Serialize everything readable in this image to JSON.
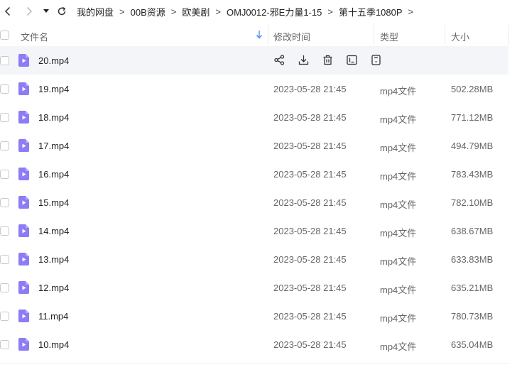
{
  "nav": {
    "back_icon": "chevron-left-icon",
    "forward_icon": "chevron-right-icon",
    "history_icon": "caret-down-icon",
    "refresh_icon": "refresh-icon"
  },
  "breadcrumb": {
    "items": [
      "我的网盘",
      "00B资源",
      "欧美剧",
      "OMJ0012-邪E力量1-15",
      "第十五季1080P"
    ],
    "separator": ">"
  },
  "table": {
    "columns": {
      "name": "文件名",
      "time": "修改时间",
      "type": "类型",
      "size": "大小"
    },
    "sort_icon": "sort-arrow-down-icon",
    "accent_color": "#4b8bf5",
    "file_icon_color": "#8c7cf5",
    "hover_row_actions": [
      "share-icon",
      "download-icon",
      "delete-icon",
      "rename-icon",
      "more-icon"
    ],
    "rows": [
      {
        "name": "20.mp4",
        "time": "",
        "type": "",
        "size": ""
      },
      {
        "name": "19.mp4",
        "time": "2023-05-28 21:45",
        "type": "mp4文件",
        "size": "502.28MB"
      },
      {
        "name": "18.mp4",
        "time": "2023-05-28 21:45",
        "type": "mp4文件",
        "size": "771.12MB"
      },
      {
        "name": "17.mp4",
        "time": "2023-05-28 21:45",
        "type": "mp4文件",
        "size": "494.79MB"
      },
      {
        "name": "16.mp4",
        "time": "2023-05-28 21:45",
        "type": "mp4文件",
        "size": "783.43MB"
      },
      {
        "name": "15.mp4",
        "time": "2023-05-28 21:45",
        "type": "mp4文件",
        "size": "782.10MB"
      },
      {
        "name": "14.mp4",
        "time": "2023-05-28 21:45",
        "type": "mp4文件",
        "size": "638.67MB"
      },
      {
        "name": "13.mp4",
        "time": "2023-05-28 21:45",
        "type": "mp4文件",
        "size": "633.83MB"
      },
      {
        "name": "12.mp4",
        "time": "2023-05-28 21:45",
        "type": "mp4文件",
        "size": "635.21MB"
      },
      {
        "name": "11.mp4",
        "time": "2023-05-28 21:45",
        "type": "mp4文件",
        "size": "780.73MB"
      },
      {
        "name": "10.mp4",
        "time": "2023-05-28 21:45",
        "type": "mp4文件",
        "size": "635.04MB"
      }
    ]
  }
}
